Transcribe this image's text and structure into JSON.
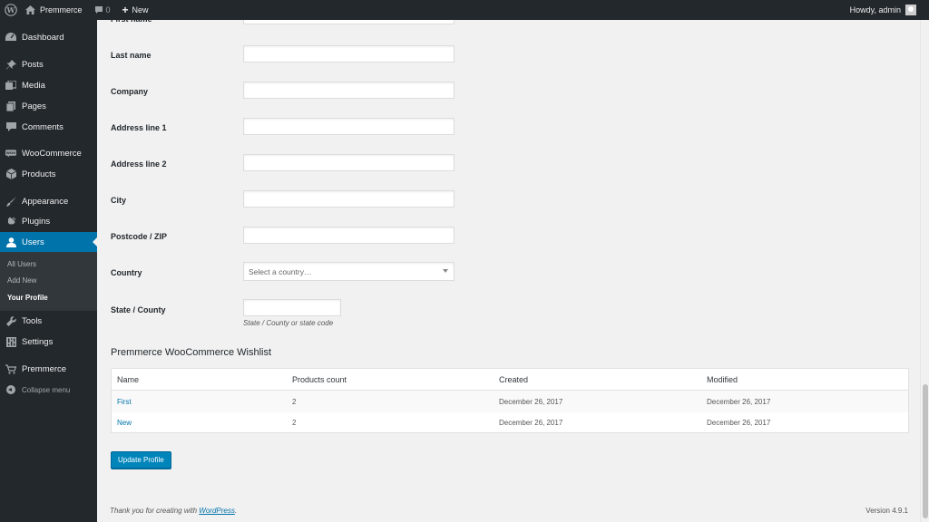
{
  "adminbar": {
    "site_name": "Premmerce",
    "comments_count": "0",
    "new_label": "New",
    "howdy": "Howdy, admin"
  },
  "sidebar": {
    "items": [
      {
        "label": "Dashboard",
        "icon": "dashboard-icon"
      },
      {
        "label": "Posts",
        "icon": "pin-icon"
      },
      {
        "label": "Media",
        "icon": "media-icon"
      },
      {
        "label": "Pages",
        "icon": "pages-icon"
      },
      {
        "label": "Comments",
        "icon": "comments-icon"
      },
      {
        "label": "WooCommerce",
        "icon": "woocommerce-icon"
      },
      {
        "label": "Products",
        "icon": "products-icon"
      },
      {
        "label": "Appearance",
        "icon": "brush-icon"
      },
      {
        "label": "Plugins",
        "icon": "plugin-icon"
      },
      {
        "label": "Users",
        "icon": "users-icon"
      },
      {
        "label": "Tools",
        "icon": "wrench-icon"
      },
      {
        "label": "Settings",
        "icon": "settings-icon"
      },
      {
        "label": "Premmerce",
        "icon": "cart-icon"
      }
    ],
    "submenu": [
      "All Users",
      "Add New",
      "Your Profile"
    ],
    "collapse_label": "Collapse menu",
    "accent": "#0073aa"
  },
  "form": {
    "first_name_label": "First name",
    "last_name_label": "Last name",
    "company_label": "Company",
    "address1_label": "Address line 1",
    "address2_label": "Address line 2",
    "city_label": "City",
    "postcode_label": "Postcode / ZIP",
    "country_label": "Country",
    "country_placeholder": "Select a country…",
    "state_label": "State / County",
    "state_desc": "State / County or state code"
  },
  "wishlist": {
    "title": "Premmerce WooCommerce Wishlist",
    "columns": [
      "Name",
      "Products count",
      "Created",
      "Modified"
    ],
    "rows": [
      {
        "name": "First",
        "count": "2",
        "created": "December 26, 2017",
        "modified": "December 26, 2017"
      },
      {
        "name": "New",
        "count": "2",
        "created": "December 26, 2017",
        "modified": "December 26, 2017"
      }
    ]
  },
  "update_button": "Update Profile",
  "footer": {
    "thanks_prefix": "Thank you for creating with ",
    "wordpress_link": "WordPress",
    "thanks_suffix": ".",
    "version": "Version 4.9.1"
  }
}
